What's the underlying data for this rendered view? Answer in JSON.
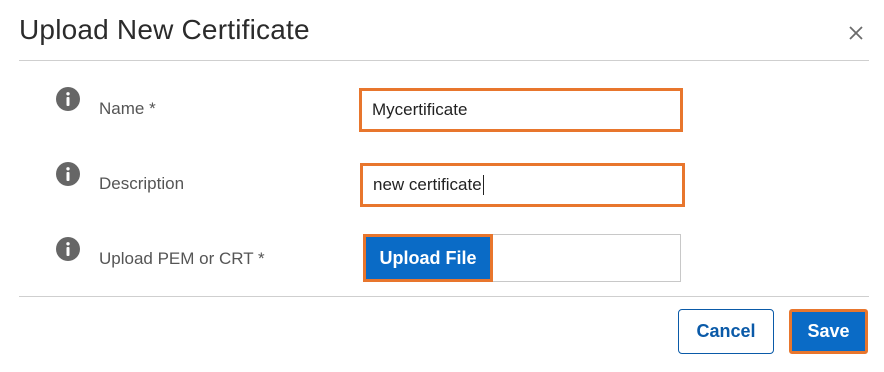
{
  "dialog": {
    "title": "Upload New Certificate",
    "close_icon": "close-icon"
  },
  "form": {
    "name": {
      "label": "Name *",
      "value": "Mycertificate",
      "icon": "info-icon"
    },
    "description": {
      "label": "Description",
      "value": "new certificate",
      "icon": "info-icon"
    },
    "upload": {
      "label": "Upload PEM or CRT *",
      "button_label": "Upload File",
      "icon": "info-icon"
    }
  },
  "footer": {
    "cancel_label": "Cancel",
    "save_label": "Save"
  },
  "colors": {
    "primary": "#0a6bc6",
    "highlight": "#e8762d",
    "info_icon": "#666666"
  }
}
